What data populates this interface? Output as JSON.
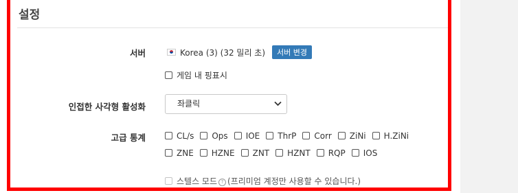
{
  "panel": {
    "title": "설정"
  },
  "server": {
    "label": "서버",
    "flag_icon": "korea-flag-icon",
    "value": "Korea (3) (32 밀리 초)",
    "change_button": "서버 변경",
    "ingame_ping_label": "게임 내 핑표시",
    "ingame_ping_checked": false
  },
  "adjacent": {
    "label": "인접한 사각형 활성화",
    "selected": "좌클릭"
  },
  "advanced": {
    "label": "고급 통계",
    "row1": [
      "CL/s",
      "Ops",
      "IOE",
      "ThrP",
      "Corr",
      "ZiNi",
      "H.ZiNi"
    ],
    "row2": [
      "ZNE",
      "HZNE",
      "ZNT",
      "HZNT",
      "RQP",
      "IOS"
    ]
  },
  "stealth": {
    "label": "스텔스 모드",
    "note": "(프리미엄 계정만 사용할 수 있습니다.)",
    "enabled": false
  },
  "colors": {
    "highlight_border": "#ff0000",
    "button_blue": "#337ab7"
  }
}
